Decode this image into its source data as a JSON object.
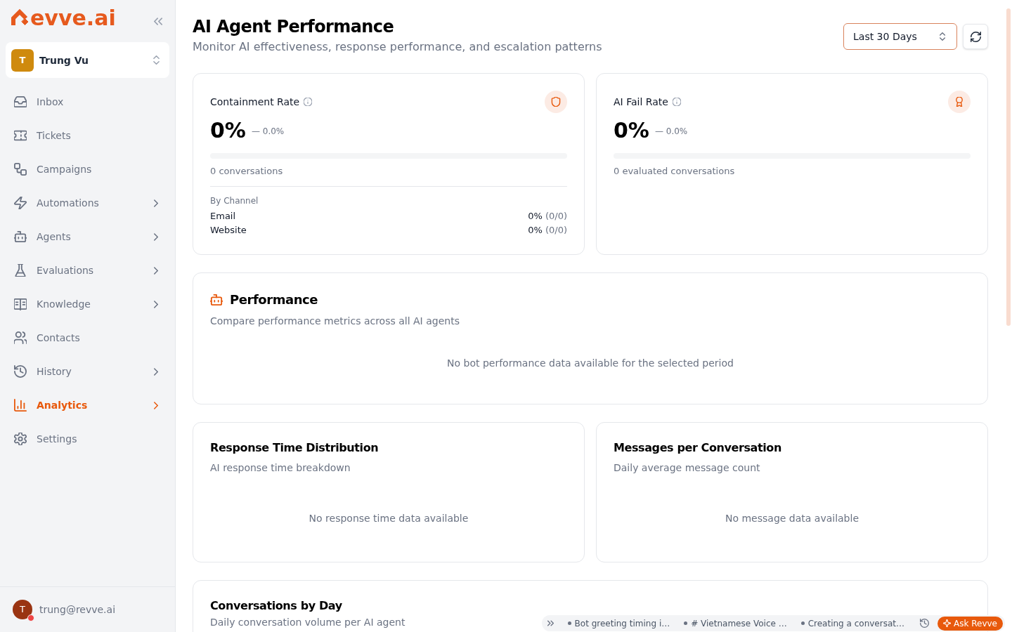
{
  "sidebar": {
    "logo": {
      "text": "evve.ai"
    },
    "workspace": {
      "initial": "T",
      "name": "Trung Vu"
    },
    "nav_items": [
      {
        "label": "Inbox",
        "has_submenu": false,
        "selected": false
      },
      {
        "label": "Tickets",
        "has_submenu": false,
        "selected": false
      },
      {
        "label": "Campaigns",
        "has_submenu": false,
        "selected": false
      },
      {
        "label": "Automations",
        "has_submenu": true,
        "selected": false
      },
      {
        "label": "Agents",
        "has_submenu": true,
        "selected": false
      },
      {
        "label": "Evaluations",
        "has_submenu": true,
        "selected": false
      },
      {
        "label": "Knowledge",
        "has_submenu": true,
        "selected": false
      },
      {
        "label": "Contacts",
        "has_submenu": false,
        "selected": false
      },
      {
        "label": "History",
        "has_submenu": true,
        "selected": false
      },
      {
        "label": "Analytics",
        "has_submenu": true,
        "selected": true
      },
      {
        "label": "Settings",
        "has_submenu": false,
        "selected": false
      }
    ],
    "user": {
      "initial": "T",
      "email": "trung@revve.ai",
      "status_indicator": true
    }
  },
  "header": {
    "title": "AI Agent Performance",
    "subtitle": "Monitor AI effectiveness, response performance, and escalation patterns",
    "date_range": {
      "value": "Last 30 Days"
    }
  },
  "metric_cards": [
    {
      "title": "Containment Rate",
      "value": "0%",
      "change": "— 0.0%",
      "level": 0,
      "caption": "0 conversations",
      "breakdown": {
        "heading": "By Channel",
        "rows": [
          {
            "channel": "Email",
            "percent": "0%",
            "ratio": "(0/0)"
          },
          {
            "channel": "Website",
            "percent": "0%",
            "ratio": "(0/0)"
          }
        ]
      }
    },
    {
      "title": "AI Fail Rate",
      "value": "0%",
      "change": "— 0.0%",
      "level": 0,
      "caption": "0 evaluated conversations"
    }
  ],
  "performance": {
    "title": "Performance",
    "subtitle": "Compare performance metrics across all AI agents",
    "empty_message": "No bot performance data available for the selected period"
  },
  "chart_cards": [
    {
      "title": "Response Time Distribution",
      "subtitle": "AI response time breakdown",
      "empty_message": "No response time data available"
    },
    {
      "title": "Messages per Conversation",
      "subtitle": "Daily average message count",
      "empty_message": "No message data available"
    }
  ],
  "conversations_by_day": {
    "title": "Conversations by Day",
    "subtitle": "Daily conversation volume per AI agent"
  },
  "assistant_bar": {
    "recent_items": [
      "Bot greeting timing i…",
      "# Vietnamese Voice …",
      "Creating a conversat…"
    ],
    "ask_button": "Ask Revve"
  }
}
